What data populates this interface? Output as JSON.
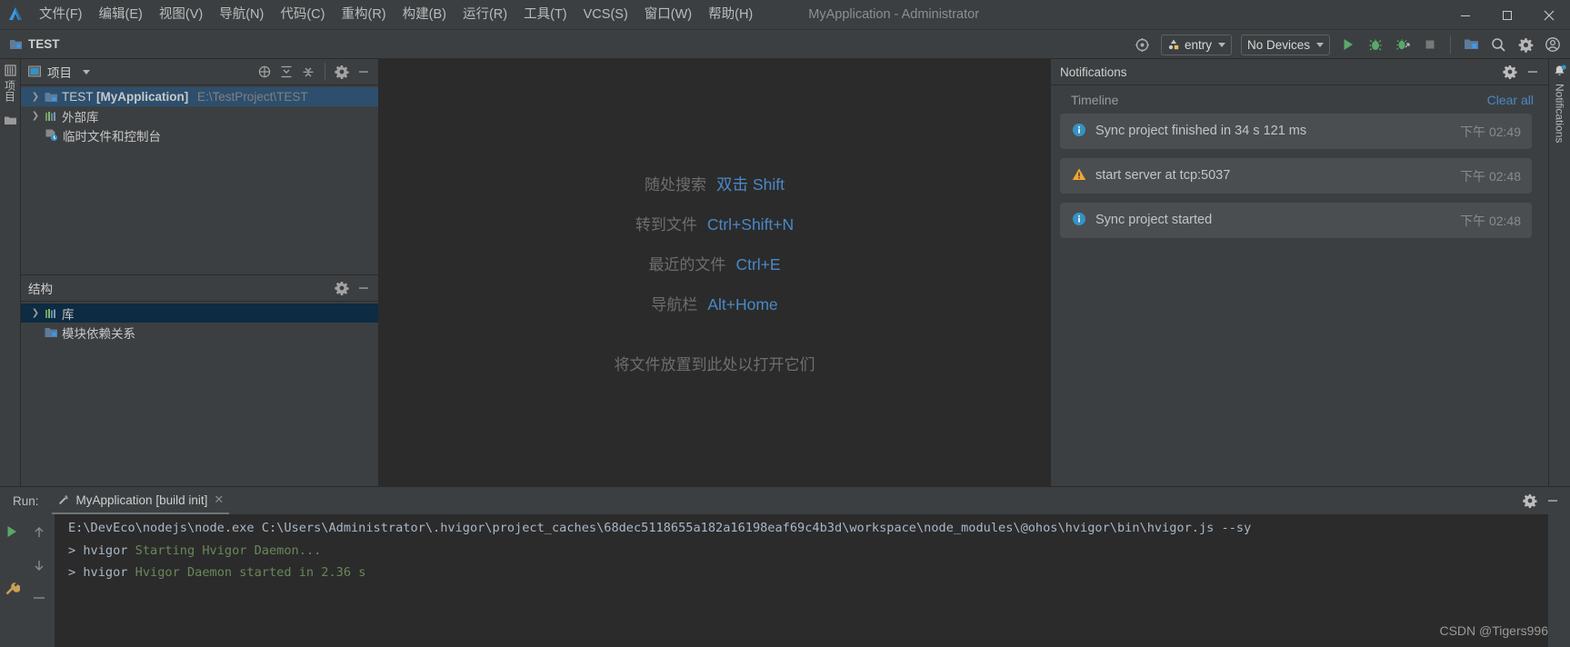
{
  "window": {
    "title": "MyApplication - Administrator",
    "minimize_label": "—",
    "maximize_label": "☐",
    "close_label": "✕"
  },
  "menu": {
    "items": [
      {
        "label": "文件(F)"
      },
      {
        "label": "编辑(E)"
      },
      {
        "label": "视图(V)"
      },
      {
        "label": "导航(N)"
      },
      {
        "label": "代码(C)"
      },
      {
        "label": "重构(R)"
      },
      {
        "label": "构建(B)"
      },
      {
        "label": "运行(R)"
      },
      {
        "label": "工具(T)"
      },
      {
        "label": "VCS(S)"
      },
      {
        "label": "窗口(W)"
      },
      {
        "label": "帮助(H)"
      }
    ]
  },
  "toolbar": {
    "breadcrumb": "TEST",
    "run_config": "entry",
    "device": "No Devices",
    "icons": [
      "target-icon",
      "run-icon",
      "debug-icon",
      "profile-icon",
      "stop-icon",
      "device-manager-icon",
      "search-icon",
      "settings-icon",
      "account-icon"
    ]
  },
  "left_rail": {
    "project_label": "项目",
    "structure_label": "结构"
  },
  "project_panel": {
    "title": "项目",
    "tree": [
      {
        "arrow": "❯",
        "icon": "module-icon",
        "label": "TEST",
        "label_bold": "[MyApplication]",
        "path": "E:\\TestProject\\TEST",
        "selected": true
      },
      {
        "arrow": "❯",
        "icon": "library-icon",
        "label": "外部库",
        "label_bold": "",
        "path": "",
        "selected": false
      },
      {
        "arrow": "",
        "icon": "scratches-icon",
        "label": "临时文件和控制台",
        "label_bold": "",
        "path": "",
        "selected": false
      }
    ]
  },
  "structure_panel": {
    "title": "结构",
    "tree": [
      {
        "arrow": "❯",
        "icon": "library-icon",
        "label": "库",
        "selected": true
      },
      {
        "arrow": "",
        "icon": "module-deps-icon",
        "label": "模块依赖关系",
        "selected": false
      }
    ]
  },
  "editor": {
    "tips": [
      {
        "label": "随处搜索",
        "key": "双击 Shift"
      },
      {
        "label": "转到文件",
        "key": "Ctrl+Shift+N"
      },
      {
        "label": "最近的文件",
        "key": "Ctrl+E"
      },
      {
        "label": "导航栏",
        "key": "Alt+Home"
      }
    ],
    "drop_hint": "将文件放置到此处以打开它们"
  },
  "notifications": {
    "title": "Notifications",
    "vertical_label": "Notifications",
    "timeline_label": "Timeline",
    "clear_all_label": "Clear all",
    "items": [
      {
        "severity": "info",
        "message": "Sync project finished in 34 s 121 ms",
        "time": "下午 02:49"
      },
      {
        "severity": "warning",
        "message": "start server at tcp:5037",
        "time": "下午 02:48"
      },
      {
        "severity": "info",
        "message": "Sync project started",
        "time": "下午 02:48"
      }
    ]
  },
  "run_panel": {
    "label": "Run:",
    "tab_label": "MyApplication [build init]",
    "tab_close": "✕",
    "console_lines": [
      {
        "segments": [
          {
            "text": "E:\\DevEco\\nodejs\\node.exe C:\\Users\\Administrator\\.hvigor\\project_caches\\68dec5118655a182a16198eaf69c4b3d\\workspace\\node_modules\\@ohos\\hvigor\\bin\\hvigor.js --sy",
            "color": "gray"
          }
        ]
      },
      {
        "segments": [
          {
            "text": "> hvigor ",
            "color": "gray"
          },
          {
            "text": "Starting Hvigor Daemon...",
            "color": "green"
          }
        ]
      },
      {
        "segments": [
          {
            "text": "> hvigor ",
            "color": "gray"
          },
          {
            "text": "Hvigor Daemon started in 2.36 s",
            "color": "green"
          }
        ]
      }
    ]
  },
  "watermark": "CSDN @Tigers996",
  "colors": {
    "accent_blue": "#4a88c7",
    "selection_blue": "#2d4f6d",
    "panel_bg": "#3c3f41",
    "editor_bg": "#2b2b2b",
    "console_green": "#6a8759",
    "warn_orange": "#f0a732",
    "info_blue": "#3592c4",
    "run_green": "#59a869"
  }
}
